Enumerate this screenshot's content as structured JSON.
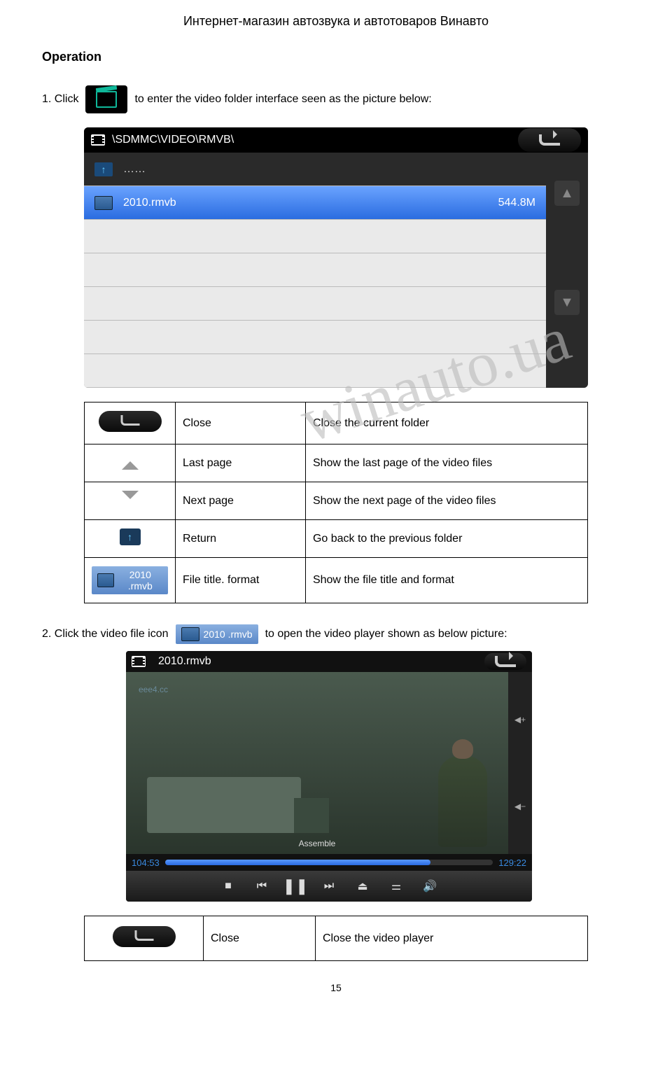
{
  "header": {
    "site_title": "Интернет-магазин автозвука и автотоваров Винавто"
  },
  "section": {
    "heading": "Operation"
  },
  "step1": {
    "prefix": "1. Click",
    "suffix": "to enter the video folder interface seen as the picture below:"
  },
  "folder": {
    "path": "\\SDMMC\\VIDEO\\RMVB\\",
    "up_row_label": "……",
    "file_name": "2010.rmvb",
    "file_size": "544.8M"
  },
  "watermark": "winauto.ua",
  "table1": {
    "rows": [
      {
        "label": "Close",
        "desc": "Close the current folder"
      },
      {
        "label": "Last page",
        "desc": "Show the last page of the video files"
      },
      {
        "label": "Next page",
        "desc": "Show the next page of the video files"
      },
      {
        "label": "Return",
        "desc": "Go back to the previous folder"
      },
      {
        "label": "File title. format",
        "desc": "Show the file title and format"
      }
    ],
    "chip_label": "2010 .rmvb"
  },
  "step2": {
    "prefix": "2. Click the video file icon",
    "chip_label": "2010 .rmvb",
    "suffix": "to open the video player shown as below picture:"
  },
  "player": {
    "title": "2010.rmvb",
    "wm_url": "eee4.cc",
    "subtitle": "Assemble",
    "time_current": "104:53",
    "time_total": "129:22",
    "vol_up": "◀+",
    "vol_down": "◀−"
  },
  "table2": {
    "row": {
      "label": "Close",
      "desc": "Close the video player"
    }
  },
  "page_number": "15"
}
